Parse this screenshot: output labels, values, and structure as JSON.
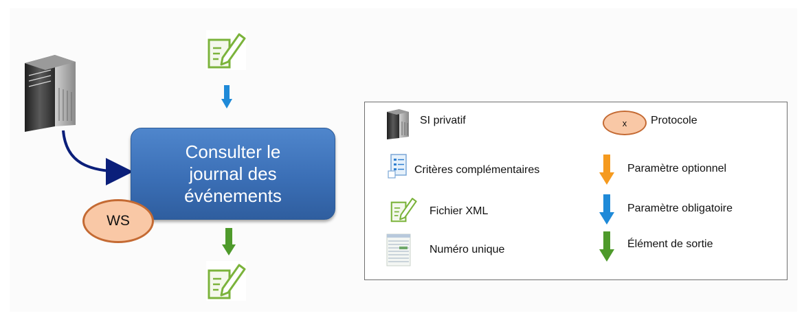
{
  "process": {
    "lines": [
      "Consulter le",
      "journal des",
      "événements"
    ]
  },
  "protocol_badge": "WS",
  "legend": {
    "items": [
      {
        "icon": "server-icon",
        "label": "SI privatif"
      },
      {
        "icon": "protocol-oval",
        "symbol": "x",
        "label": "Protocole"
      },
      {
        "icon": "document-list-icon",
        "label": "Critères  complémentaires"
      },
      {
        "icon": "orange-arrow-down-icon",
        "label": "Paramètre optionnel"
      },
      {
        "icon": "xml-file-icon",
        "label": "Fichier XML"
      },
      {
        "icon": "blue-arrow-down-icon",
        "label": "Paramètre obligatoire"
      },
      {
        "icon": "table-sheet-icon",
        "label": "Numéro unique"
      },
      {
        "icon": "green-arrow-down-icon",
        "label": "Élément de sortie"
      }
    ]
  },
  "colors": {
    "process_fill": "#3b6fb6",
    "oval_fill": "#f9c8a6",
    "oval_stroke": "#c46a33",
    "blue_arrow": "#1f8ad8",
    "green_arrow": "#4e9a2b",
    "orange_arrow": "#f59a1f",
    "navy_connector": "#0b1f7a",
    "xml_green": "#7bb33b"
  }
}
